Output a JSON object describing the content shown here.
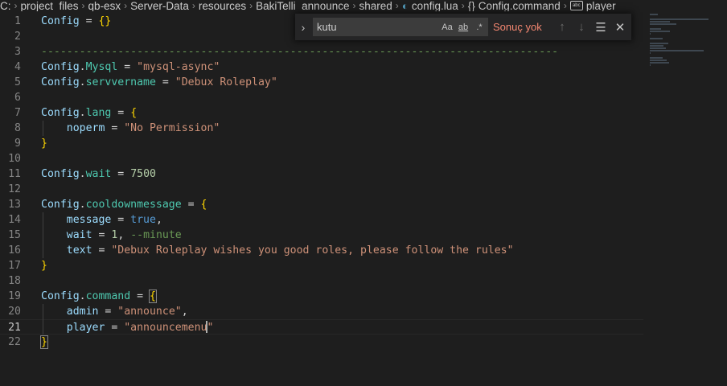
{
  "breadcrumb": {
    "items": [
      "C:",
      "project_files",
      "qb-esx",
      "Server-Data",
      "resources",
      "BakiTelli_announce",
      "shared",
      "config.lua",
      "Config.command",
      "player"
    ]
  },
  "find": {
    "query": "kutu",
    "match_case": "Aa",
    "whole_word": "ab",
    "regex": ".*",
    "result": "Sonuç yok"
  },
  "lines": [
    {
      "n": "1",
      "tokens": [
        [
          "var",
          "Config"
        ],
        [
          "plain",
          " = "
        ],
        [
          "brace",
          "{}"
        ]
      ]
    },
    {
      "n": "2",
      "tokens": []
    },
    {
      "n": "3",
      "tokens": [
        [
          "cm",
          "---------------------------------------------------------------------------------"
        ]
      ]
    },
    {
      "n": "4",
      "tokens": [
        [
          "var",
          "Config"
        ],
        [
          "dot",
          "."
        ],
        [
          "field",
          "Mysql"
        ],
        [
          "plain",
          " = "
        ],
        [
          "str",
          "\"mysql-async\""
        ]
      ]
    },
    {
      "n": "5",
      "tokens": [
        [
          "var",
          "Config"
        ],
        [
          "dot",
          "."
        ],
        [
          "field",
          "servvername"
        ],
        [
          "plain",
          " = "
        ],
        [
          "str",
          "\"Debux Roleplay\""
        ]
      ]
    },
    {
      "n": "6",
      "tokens": []
    },
    {
      "n": "7",
      "tokens": [
        [
          "var",
          "Config"
        ],
        [
          "dot",
          "."
        ],
        [
          "field",
          "lang"
        ],
        [
          "plain",
          " = "
        ],
        [
          "brace",
          "{"
        ]
      ]
    },
    {
      "n": "8",
      "tokens": [
        [
          "plain",
          "    "
        ],
        [
          "var",
          "noperm"
        ],
        [
          "plain",
          " = "
        ],
        [
          "str",
          "\"No Permission\""
        ]
      ]
    },
    {
      "n": "9",
      "tokens": [
        [
          "brace",
          "}"
        ]
      ]
    },
    {
      "n": "10",
      "tokens": []
    },
    {
      "n": "11",
      "tokens": [
        [
          "var",
          "Config"
        ],
        [
          "dot",
          "."
        ],
        [
          "field",
          "wait"
        ],
        [
          "plain",
          " = "
        ],
        [
          "num",
          "7500"
        ]
      ]
    },
    {
      "n": "12",
      "tokens": []
    },
    {
      "n": "13",
      "tokens": [
        [
          "var",
          "Config"
        ],
        [
          "dot",
          "."
        ],
        [
          "field",
          "cooldownmessage"
        ],
        [
          "plain",
          " = "
        ],
        [
          "brace",
          "{"
        ]
      ]
    },
    {
      "n": "14",
      "tokens": [
        [
          "plain",
          "    "
        ],
        [
          "var",
          "message"
        ],
        [
          "plain",
          " = "
        ],
        [
          "kw",
          "true"
        ],
        [
          "plain",
          ","
        ]
      ]
    },
    {
      "n": "15",
      "tokens": [
        [
          "plain",
          "    "
        ],
        [
          "var",
          "wait"
        ],
        [
          "plain",
          " = "
        ],
        [
          "num",
          "1"
        ],
        [
          "plain",
          ", "
        ],
        [
          "cm",
          "--minute"
        ]
      ]
    },
    {
      "n": "16",
      "tokens": [
        [
          "plain",
          "    "
        ],
        [
          "var",
          "text"
        ],
        [
          "plain",
          " = "
        ],
        [
          "str",
          "\"Debux Roleplay wishes you good roles, please follow the rules\""
        ]
      ]
    },
    {
      "n": "17",
      "tokens": [
        [
          "brace",
          "}"
        ]
      ]
    },
    {
      "n": "18",
      "tokens": []
    },
    {
      "n": "19",
      "tokens": [
        [
          "var",
          "Config"
        ],
        [
          "dot",
          "."
        ],
        [
          "field",
          "command"
        ],
        [
          "plain",
          " = "
        ],
        [
          "brace",
          "{"
        ]
      ]
    },
    {
      "n": "20",
      "tokens": [
        [
          "plain",
          "    "
        ],
        [
          "var",
          "admin"
        ],
        [
          "plain",
          " = "
        ],
        [
          "str",
          "\"announce\""
        ],
        [
          "plain",
          ","
        ]
      ]
    },
    {
      "n": "21",
      "tokens": [
        [
          "plain",
          "    "
        ],
        [
          "var",
          "player"
        ],
        [
          "plain",
          " = "
        ],
        [
          "str",
          "\"announcemenu"
        ],
        [
          "cursor",
          ""
        ],
        [
          "str",
          "\""
        ]
      ]
    },
    {
      "n": "22",
      "tokens": [
        [
          "brace",
          "}"
        ]
      ]
    }
  ],
  "active_line": "21"
}
